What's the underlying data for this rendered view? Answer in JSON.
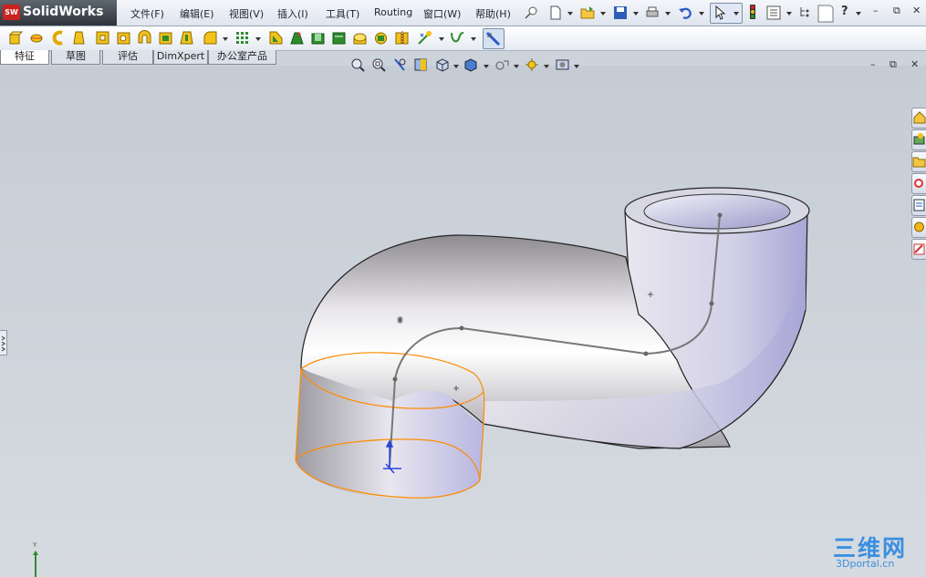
{
  "app": {
    "name": "SolidWorks",
    "logo_text": "SW"
  },
  "menu": [
    "文件(F)",
    "编辑(E)",
    "视图(V)",
    "插入(I)",
    "工具(T)",
    "Routing",
    "窗口(W)",
    "帮助(H)"
  ],
  "tabs": [
    {
      "label": "特征",
      "active": true
    },
    {
      "label": "草图",
      "active": false
    },
    {
      "label": "评估",
      "active": false
    },
    {
      "label": "DimXpert",
      "active": false
    },
    {
      "label": "办公室产品",
      "active": false
    }
  ],
  "window_controls": {
    "minimize": "–",
    "restore": "⧉",
    "close": "✕"
  },
  "help_glyph": "?",
  "triad_label": "Y",
  "watermark": {
    "text": "三维网",
    "url": "3Dportal.cn"
  },
  "colors": {
    "selection_edge": "#ff8a00",
    "triad": "#2a42e0",
    "pipe": "#e8e6ea"
  }
}
